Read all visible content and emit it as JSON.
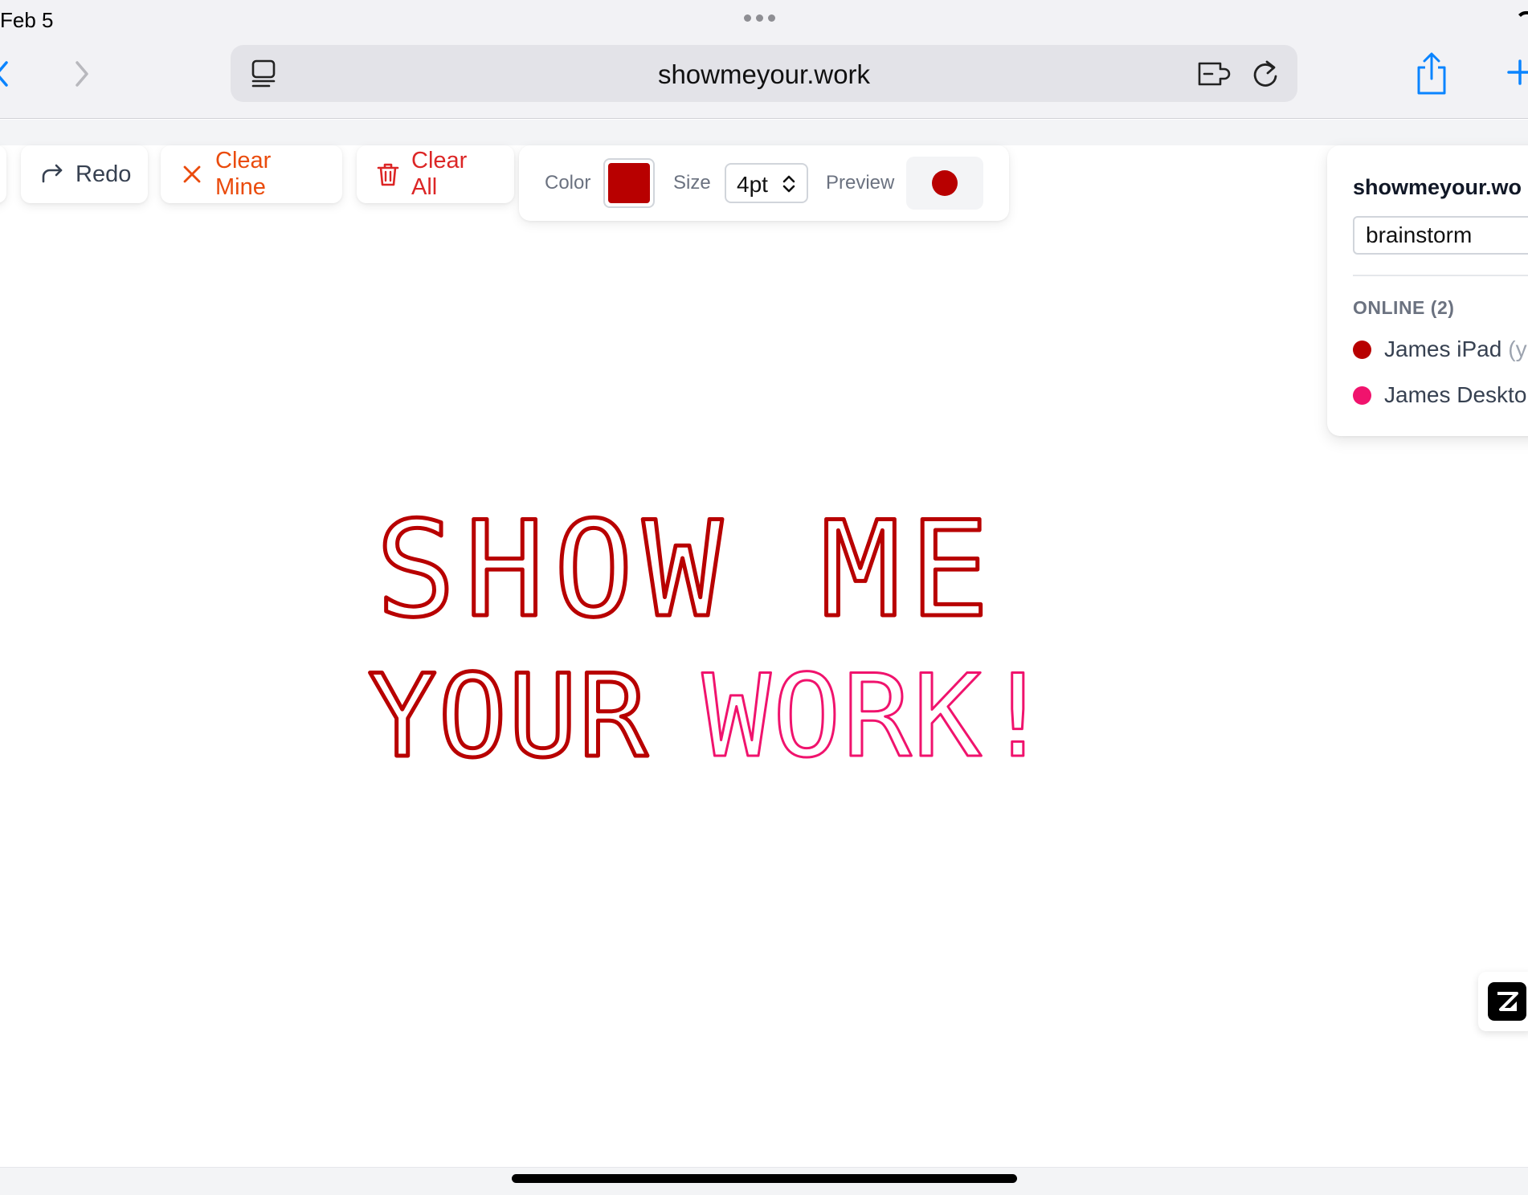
{
  "status_bar": {
    "date": "Feb 5"
  },
  "browser": {
    "url": "showmeyour.work"
  },
  "toolbar": {
    "redo_label": "Redo",
    "clear_mine_label": "Clear Mine",
    "clear_all_label": "Clear All"
  },
  "controls": {
    "color_label": "Color",
    "color_value": "#b80000",
    "size_label": "Size",
    "size_value": "4pt",
    "preview_label": "Preview"
  },
  "panel": {
    "title": "showmeyour.wo",
    "room_value": "brainstorm",
    "online_heading": "ONLINE (2)",
    "users": [
      {
        "name": "James iPad",
        "suffix": "(y",
        "color": "#b80000"
      },
      {
        "name": "James Deskto",
        "color": "#f0136d"
      }
    ]
  },
  "drawing": {
    "line1": "SHOW ME",
    "line2_part1": "YOUR",
    "line2_part2": "WORK!",
    "colors": {
      "ipad": "#b80000",
      "desktop": "#f0136d"
    }
  },
  "colors": {
    "accent_blue": "#0a84ff",
    "clear_mine": "#ea4b0c",
    "clear_all": "#dc2626"
  }
}
